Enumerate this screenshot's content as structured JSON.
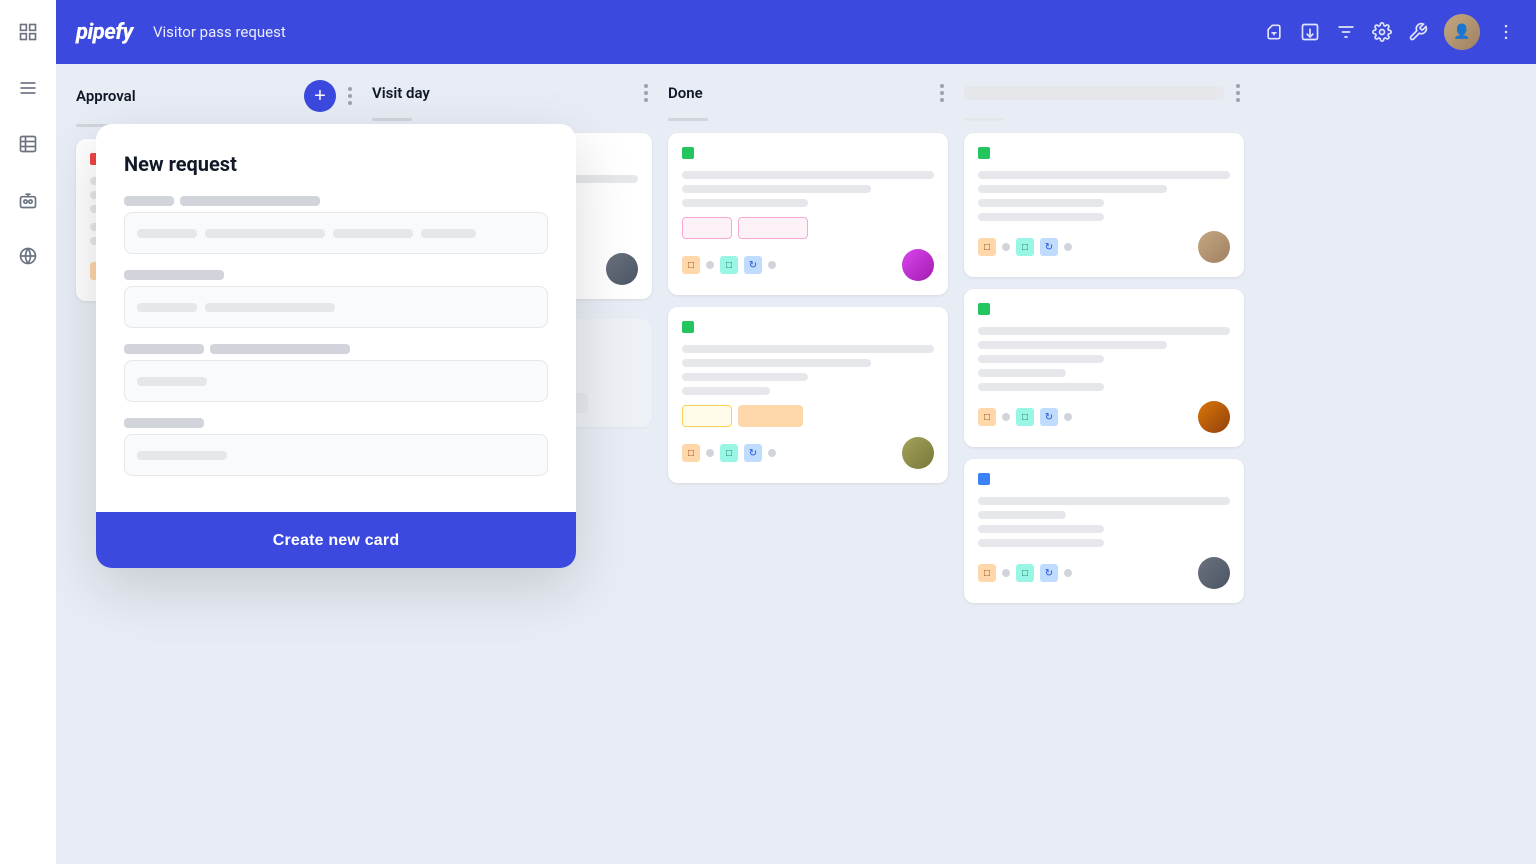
{
  "app": {
    "title": "Visitor pass request"
  },
  "header": {
    "logo": "pipefy",
    "pipe_title": "Visitor pass request",
    "user_menu_label": "User menu"
  },
  "sidebar": {
    "icons": [
      {
        "name": "grid-icon",
        "label": "Grid"
      },
      {
        "name": "list-icon",
        "label": "List"
      },
      {
        "name": "table-icon",
        "label": "Table"
      },
      {
        "name": "bot-icon",
        "label": "Bot"
      },
      {
        "name": "globe-icon",
        "label": "Globe"
      }
    ]
  },
  "columns": [
    {
      "id": "approval",
      "title": "Approval",
      "has_add": true,
      "cards": [
        {
          "indicator": "red",
          "lines": [
            "full",
            "3q",
            "small",
            "half",
            "half"
          ],
          "badges": [],
          "avatar_style": "av-brown"
        }
      ]
    },
    {
      "id": "visit_day",
      "title": "Visit day",
      "has_add": false,
      "cards": [
        {
          "indicators": [
            "red",
            "green"
          ],
          "lines": [
            "full",
            "3q",
            "half",
            "half"
          ],
          "badges": [
            "outline-gray",
            "filled-gray"
          ],
          "avatar_style": "av-gray"
        }
      ]
    },
    {
      "id": "done",
      "title": "Done",
      "has_add": false,
      "cards": [
        {
          "indicator": "green",
          "lines": [
            "full",
            "3q",
            "half"
          ],
          "badges": [
            "outline-pink",
            "outline-pink"
          ],
          "avatar_style": "av-pink"
        },
        {
          "indicator": "green",
          "lines": [
            "full",
            "3q",
            "half",
            "small"
          ],
          "badges": [
            "outline-yellow",
            "filled-orange"
          ],
          "avatar_style": "av-olive"
        }
      ]
    },
    {
      "id": "col4",
      "title": "",
      "has_add": false,
      "cards": [
        {
          "indicator": "green",
          "lines": [
            "full",
            "3q",
            "half",
            "half"
          ],
          "badges": [],
          "avatar_style": "av-beige"
        },
        {
          "indicator": "green",
          "lines": [
            "full",
            "3q",
            "half",
            "small",
            "half"
          ],
          "badges": [],
          "avatar_style": "av-brown"
        },
        {
          "indicator": "blue",
          "lines": [
            "full",
            "small",
            "half",
            "half"
          ],
          "badges": [],
          "avatar_style": "av-gray"
        }
      ]
    }
  ],
  "new_request_form": {
    "title": "New request",
    "fields": [
      {
        "label_bars": [
          "short",
          "long"
        ],
        "input_bars": [
          "w1",
          "w2",
          "w3",
          "w4"
        ]
      },
      {
        "label_bars": [
          "medium"
        ],
        "input_bars": [
          "w1",
          "w5"
        ]
      },
      {
        "label_bars": [
          "xl",
          "long"
        ],
        "input_bars": [
          "w6"
        ]
      },
      {
        "label_bars": [
          "xshort"
        ],
        "input_bars": [
          "w7"
        ]
      }
    ],
    "submit_label": "Create new card"
  }
}
